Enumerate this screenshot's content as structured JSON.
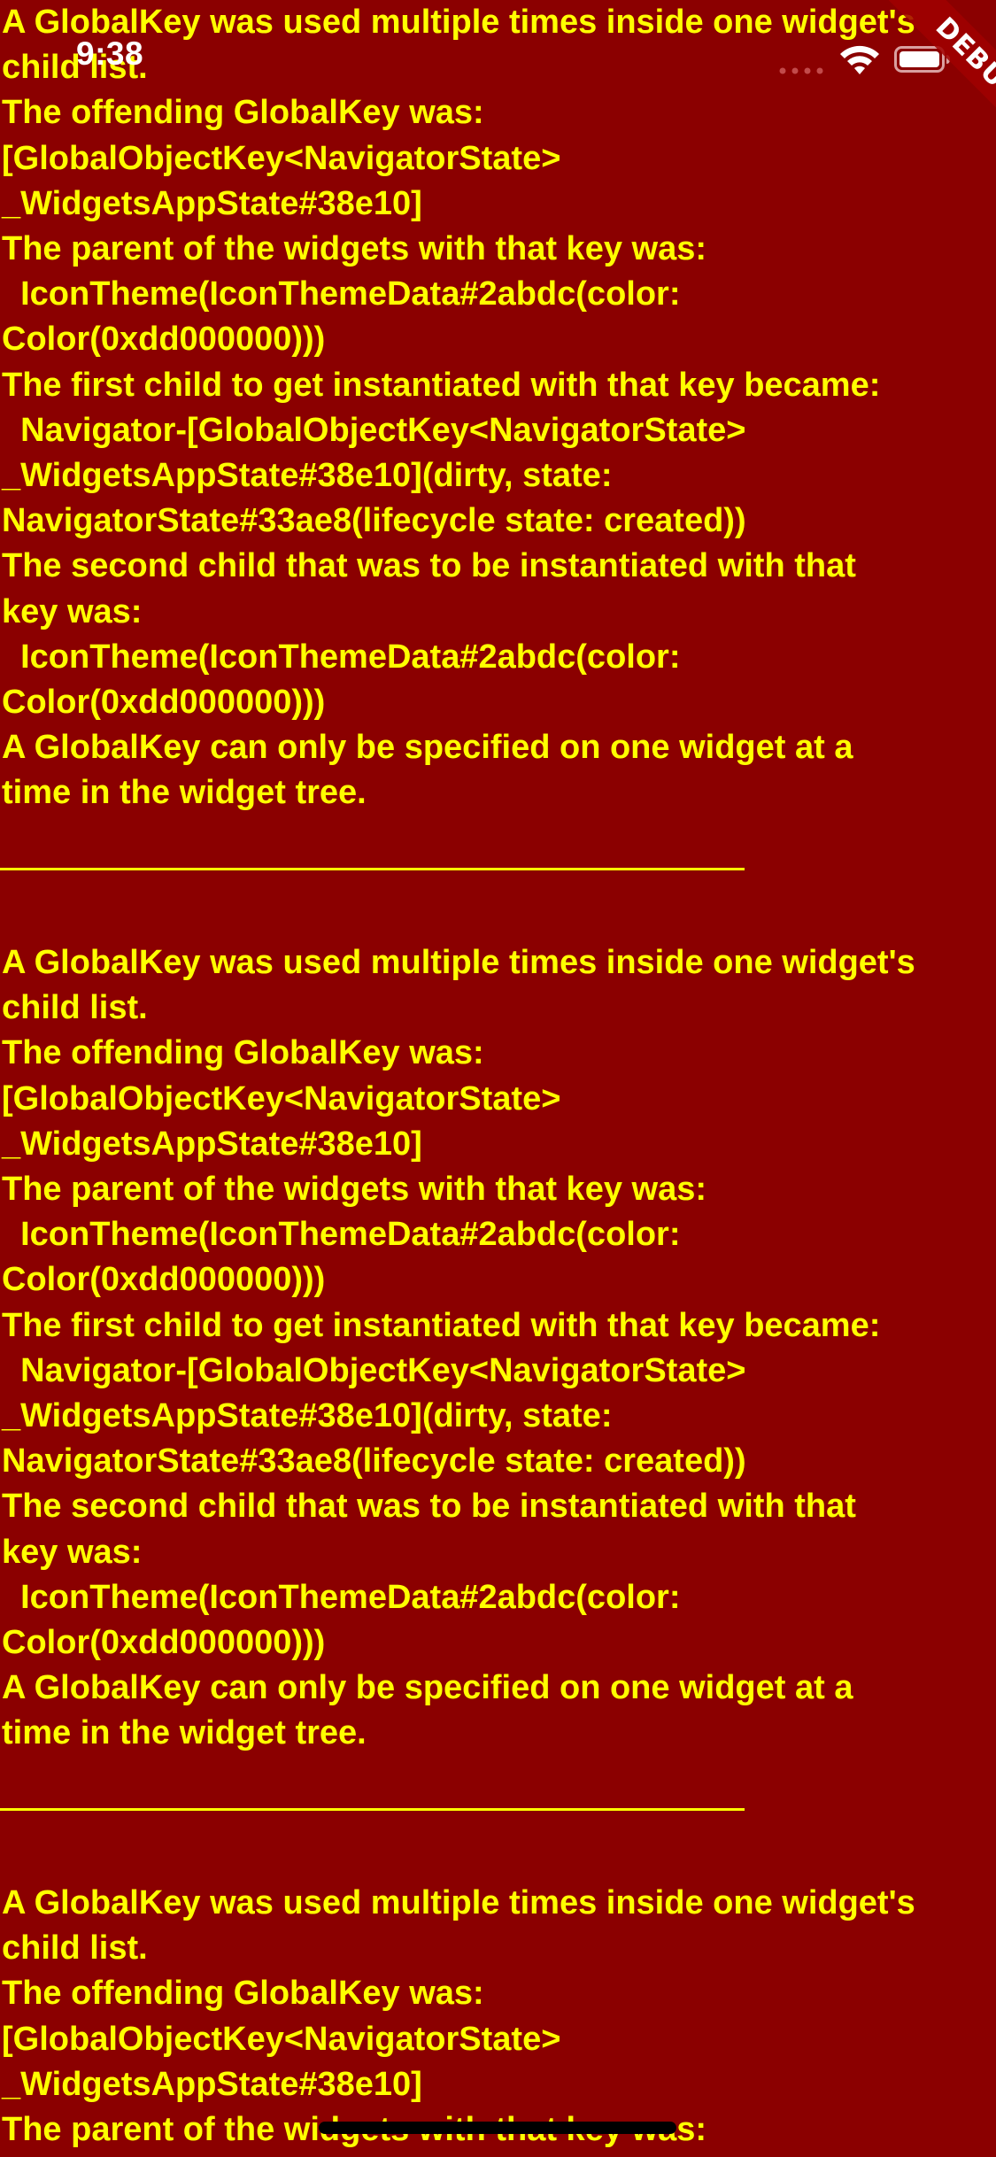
{
  "status_bar": {
    "time": "9:38"
  },
  "debug_banner": {
    "label": "DEBUG"
  },
  "error": {
    "message": "A GlobalKey was used multiple times inside one widget's\nchild list.\nThe offending GlobalKey was:\n[GlobalObjectKey<NavigatorState>\n_WidgetsAppState#38e10]\nThe parent of the widgets with that key was:\n  IconTheme(IconThemeData#2abdc(color:\nColor(0xdd000000)))\nThe first child to get instantiated with that key became:\n  Navigator-[GlobalObjectKey<NavigatorState>\n_WidgetsAppState#38e10](dirty, state:\nNavigatorState#33ae8(lifecycle state: created))\nThe second child that was to be instantiated with that\nkey was:\n  IconTheme(IconThemeData#2abdc(color:\nColor(0xdd000000)))\nA GlobalKey can only be specified on one widget at a\ntime in the widget tree.",
    "message_partial": "A GlobalKey was used multiple times inside one widget's\nchild list.\nThe offending GlobalKey was:\n[GlobalObjectKey<NavigatorState>\n_WidgetsAppState#38e10]\nThe parent of the widgets with that key was:"
  },
  "colors": {
    "background": "#8b0000",
    "text": "#ffff00",
    "status_text": "#ffffff"
  },
  "icons": {
    "signal": "signal-dots-icon",
    "wifi": "wifi-icon",
    "battery": "battery-icon"
  }
}
